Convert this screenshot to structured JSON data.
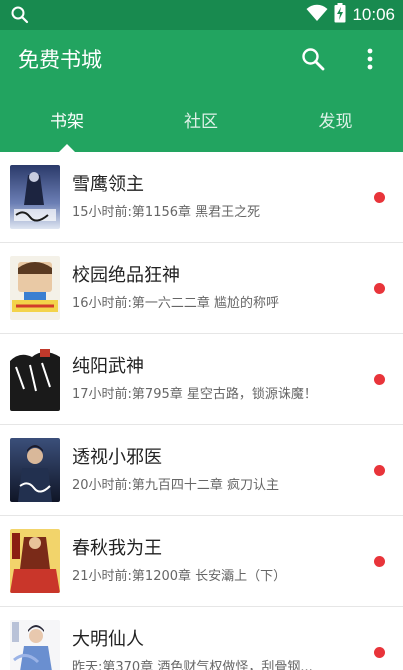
{
  "status_bar": {
    "time": "10:06",
    "icons": [
      "search-icon",
      "wifi-icon",
      "battery-charging-icon"
    ]
  },
  "app_bar": {
    "title": "免费书城",
    "actions": [
      "search-icon",
      "more-vert-icon"
    ]
  },
  "tabs": [
    {
      "label": "书架",
      "active": true
    },
    {
      "label": "社区",
      "active": false
    },
    {
      "label": "发现",
      "active": false
    }
  ],
  "colors": {
    "primary": "#22a460",
    "status_bar": "#188a4f",
    "unread_dot": "#e8343a"
  },
  "books": [
    {
      "title": "雪鹰领主",
      "update": "15小时前:第1156章 黑君王之死",
      "unread": true
    },
    {
      "title": "校园绝品狂神",
      "update": "16小时前:第一六二二章 尴尬的称呼",
      "unread": true
    },
    {
      "title": "纯阳武神",
      "update": "17小时前:第795章 星空古路，锁源诛魔！",
      "unread": true
    },
    {
      "title": "透视小邪医",
      "update": "20小时前:第九百四十二章 疯刀认主",
      "unread": true
    },
    {
      "title": "春秋我为王",
      "update": "21小时前:第1200章 长安灞上（下）",
      "unread": true
    },
    {
      "title": "大明仙人",
      "update": "昨天:第370章 酒色财气权做怪，刮骨钢...",
      "unread": true
    }
  ]
}
